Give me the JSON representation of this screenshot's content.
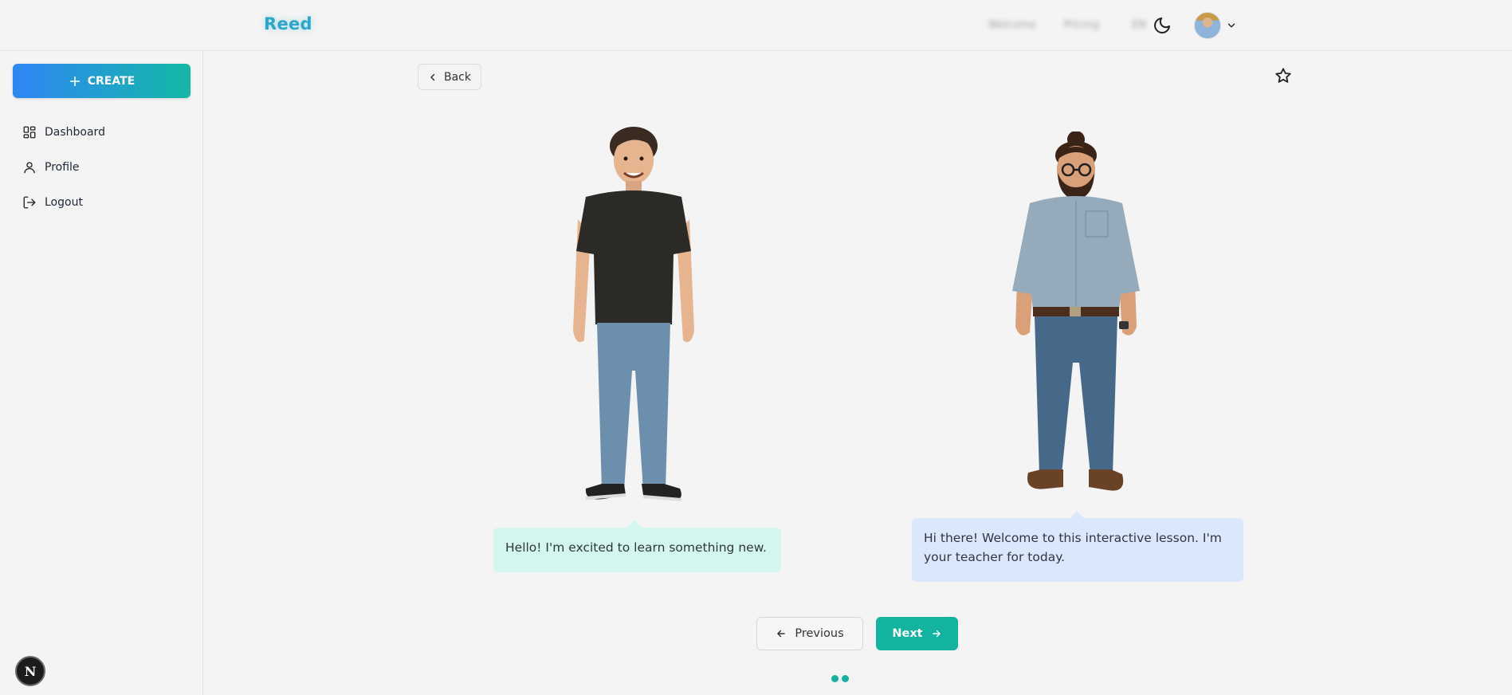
{
  "header": {
    "brand": "Reed",
    "blurred_link_1": "Welcome",
    "blurred_link_2": "Pricing",
    "blurred_link_3": "EN"
  },
  "sidebar": {
    "create_label": "CREATE",
    "items": [
      {
        "label": "Dashboard",
        "icon": "dashboard-icon"
      },
      {
        "label": "Profile",
        "icon": "user-icon"
      },
      {
        "label": "Logout",
        "icon": "logout-icon"
      }
    ],
    "badge": "N"
  },
  "main": {
    "back_label": "Back",
    "student_message": "Hello! I'm excited to learn something new.",
    "teacher_message": "Hi there! Welcome to this interactive lesson. I'm your teacher for today.",
    "previous_label": "Previous",
    "next_label": "Next",
    "page_dots": 2
  },
  "colors": {
    "brand": "#2aa7c9",
    "accent": "#14b3a0",
    "student_bubble": "#d3f6ee",
    "teacher_bubble": "#dbe8fb"
  }
}
